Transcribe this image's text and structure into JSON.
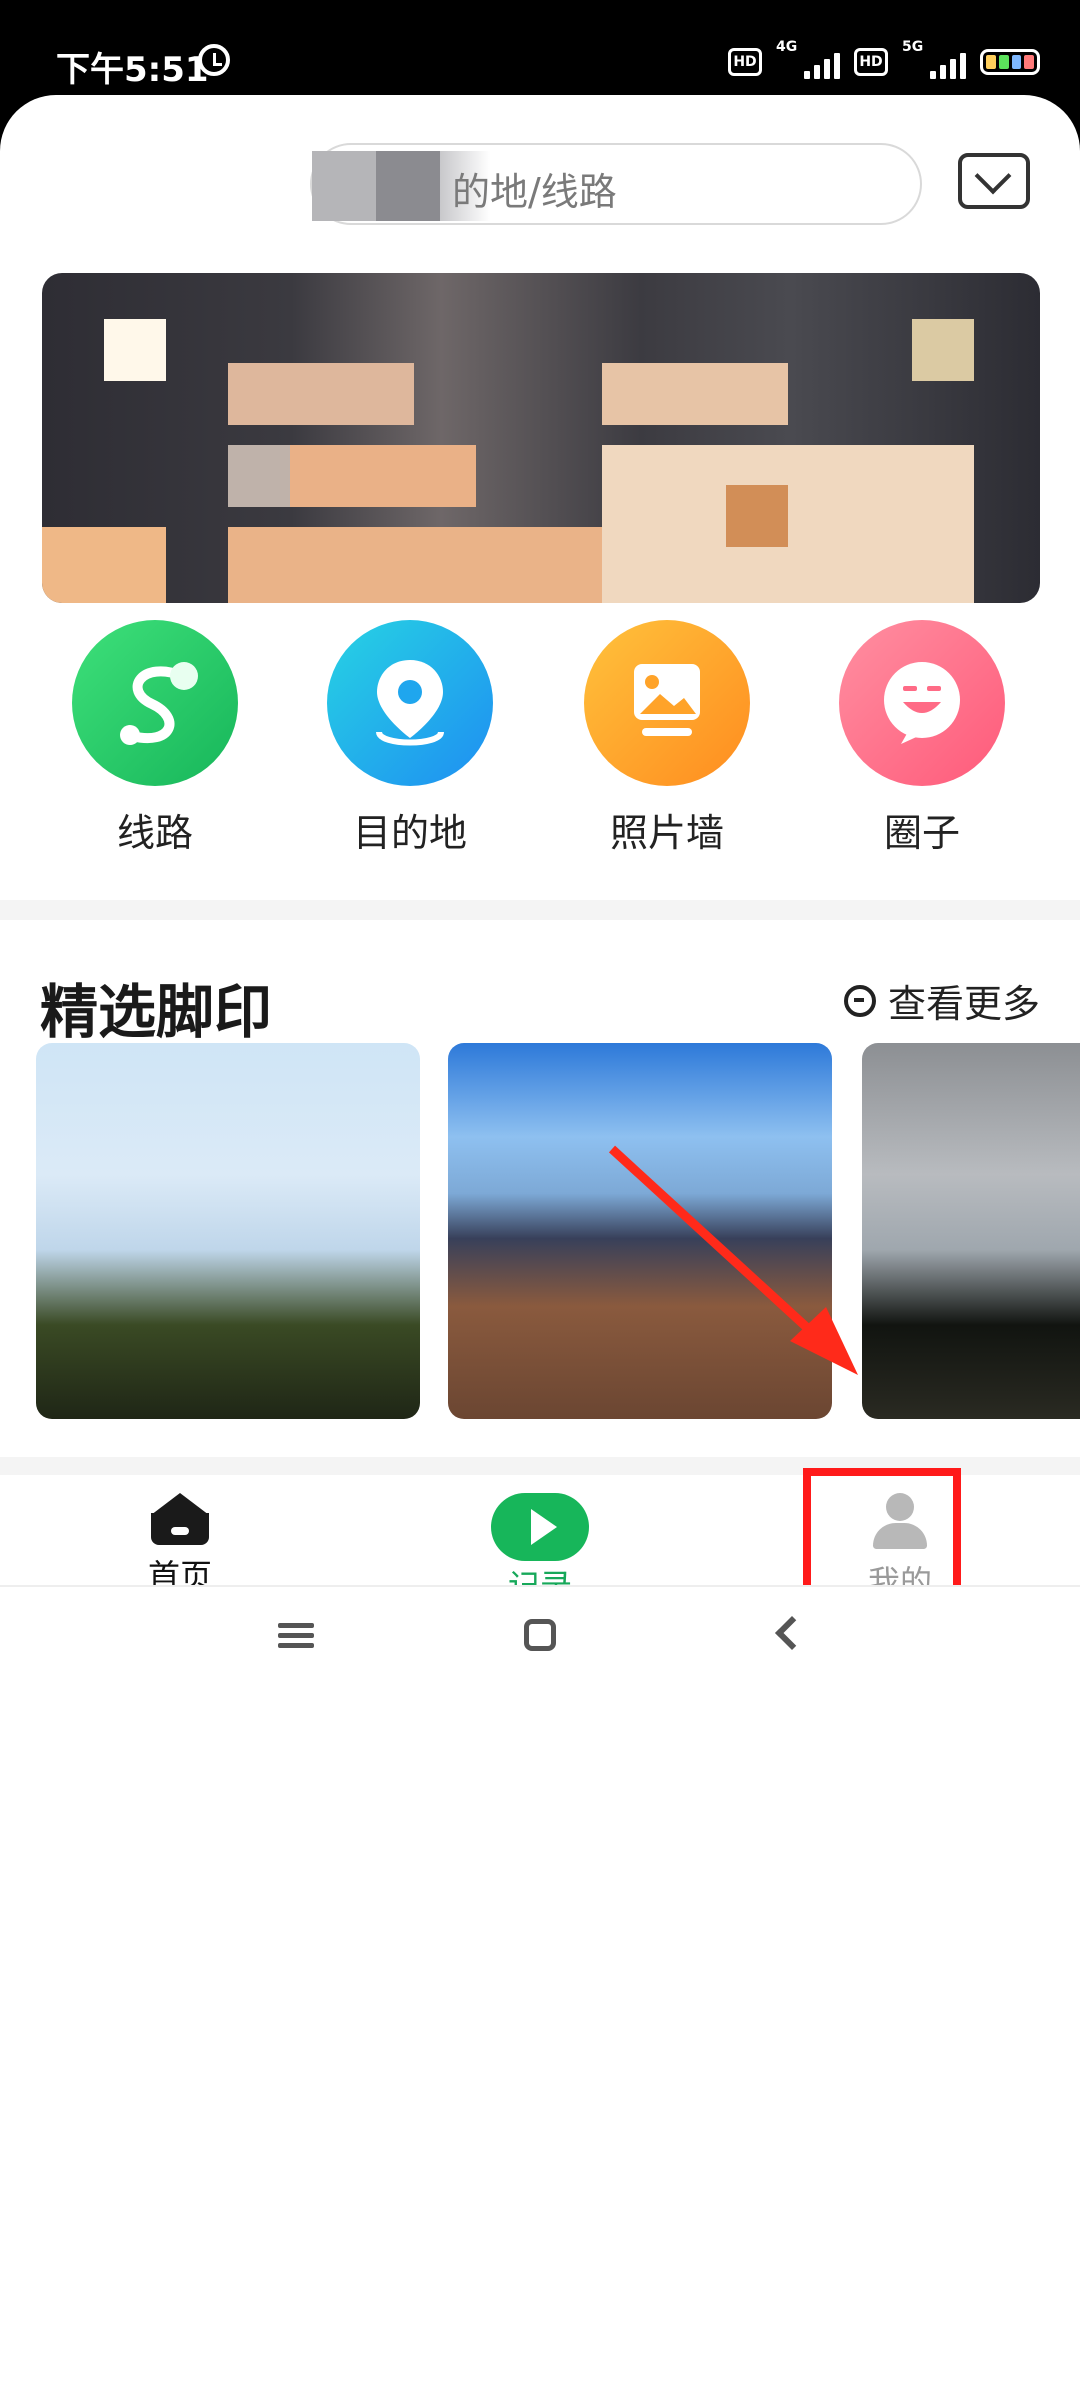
{
  "status_bar": {
    "time": "下午5:51",
    "network_left": "4G",
    "network_right": "5G",
    "hd_label": "HD"
  },
  "search": {
    "placeholder": "的地/线路"
  },
  "nav": {
    "items": [
      {
        "label": "线路",
        "icon": "route-icon"
      },
      {
        "label": "目的地",
        "icon": "location-icon"
      },
      {
        "label": "照片墙",
        "icon": "photo-icon"
      },
      {
        "label": "圈子",
        "icon": "chat-face-icon"
      }
    ]
  },
  "section": {
    "title": "精选脚印",
    "more_label": "查看更多"
  },
  "tabs": {
    "home": "首页",
    "record": "记录",
    "mine": "我的"
  },
  "colors": {
    "accent": "#17b65a",
    "highlight": "#ff1a1a"
  }
}
